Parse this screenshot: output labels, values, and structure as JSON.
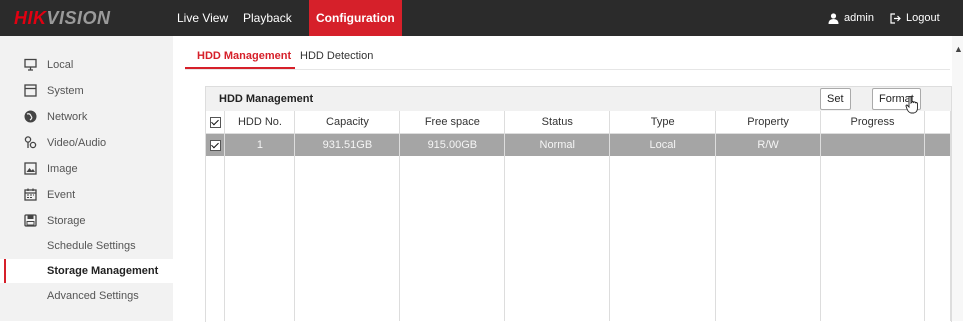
{
  "brand": {
    "logo_red": "HIK",
    "logo_gray": "VISION"
  },
  "topnav": {
    "live_view": "Live View",
    "playback": "Playback",
    "configuration": "Configuration",
    "user": "admin",
    "logout": "Logout"
  },
  "sidebar": {
    "items": [
      {
        "label": "Local",
        "icon": "monitor-icon"
      },
      {
        "label": "System",
        "icon": "system-icon"
      },
      {
        "label": "Network",
        "icon": "network-globe-icon"
      },
      {
        "label": "Video/Audio",
        "icon": "video-audio-icon"
      },
      {
        "label": "Image",
        "icon": "image-icon"
      },
      {
        "label": "Event",
        "icon": "event-calendar-icon"
      },
      {
        "label": "Storage",
        "icon": "storage-disk-icon"
      }
    ],
    "storage_sub": [
      {
        "label": "Schedule Settings"
      },
      {
        "label": "Storage Management",
        "active": true
      },
      {
        "label": "Advanced Settings"
      }
    ]
  },
  "tabs": {
    "hdd_management": "HDD Management",
    "hdd_detection": "HDD Detection"
  },
  "panel": {
    "title": "HDD Management",
    "set_button": "Set",
    "format_button": "Format",
    "columns": [
      "HDD No.",
      "Capacity",
      "Free space",
      "Status",
      "Type",
      "Property",
      "Progress"
    ],
    "rows": [
      {
        "hdd_no": "1",
        "capacity": "931.51GB",
        "free_space": "915.00GB",
        "status": "Normal",
        "type": "Local",
        "property": "R/W",
        "progress": ""
      }
    ]
  },
  "colors": {
    "accent": "#d6202a",
    "topbar": "#2b2b2b",
    "selected_row": "#a5a5a5"
  }
}
